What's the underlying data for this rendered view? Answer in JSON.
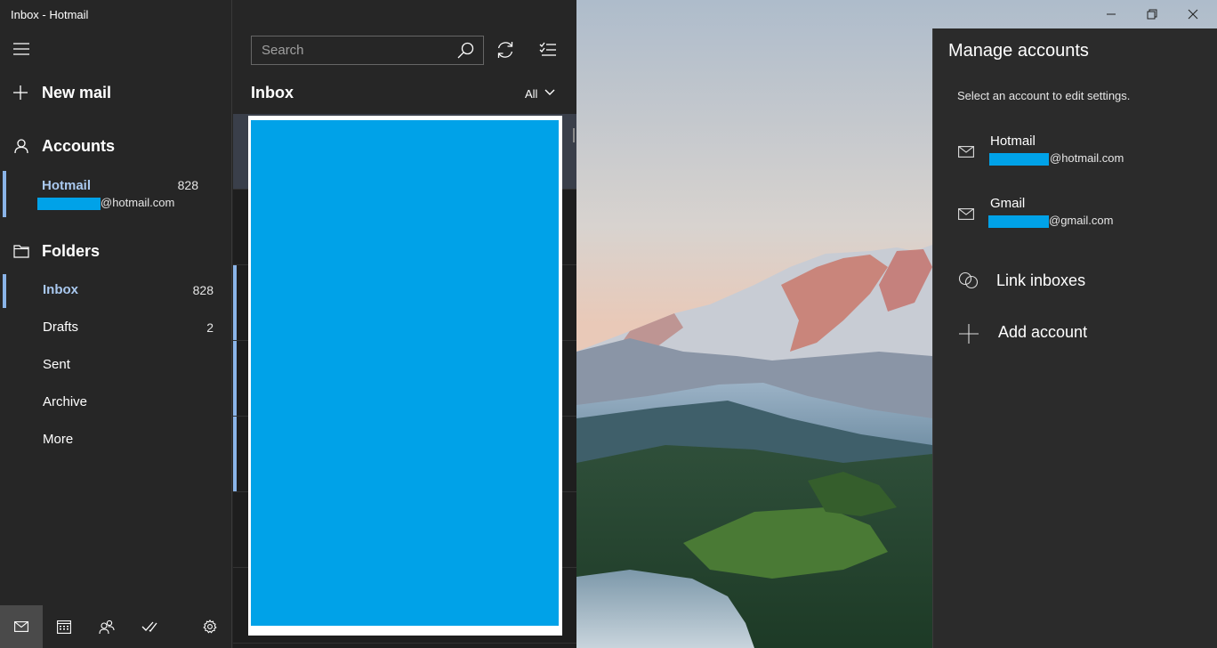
{
  "window": {
    "title": "Inbox - Hotmail"
  },
  "nav": {
    "new_mail": "New mail",
    "accounts_heading": "Accounts",
    "account": {
      "name": "Hotmail",
      "count": "828",
      "email_suffix": "@hotmail.com"
    },
    "folders_heading": "Folders",
    "folders": [
      {
        "label": "Inbox",
        "count": "828"
      },
      {
        "label": "Drafts",
        "count": "2"
      },
      {
        "label": "Sent",
        "count": ""
      },
      {
        "label": "Archive",
        "count": ""
      },
      {
        "label": "More",
        "count": ""
      }
    ],
    "bottom_icons": [
      "mail-icon",
      "calendar-icon",
      "people-icon",
      "todo-icon",
      "settings-icon"
    ]
  },
  "list": {
    "search_placeholder": "Search",
    "title": "Inbox",
    "filter": "All"
  },
  "flyout": {
    "title": "Manage accounts",
    "subtitle": "Select an account to edit settings.",
    "accounts": [
      {
        "name": "Hotmail",
        "email_suffix": "@hotmail.com"
      },
      {
        "name": "Gmail",
        "email_suffix": "@gmail.com"
      }
    ],
    "link_inboxes": "Link inboxes",
    "add_account": "Add account"
  },
  "colors": {
    "accent": "#8ab4e8",
    "redaction": "#00a2e8",
    "pane": "#262626",
    "flyout": "#2b2b2b"
  }
}
